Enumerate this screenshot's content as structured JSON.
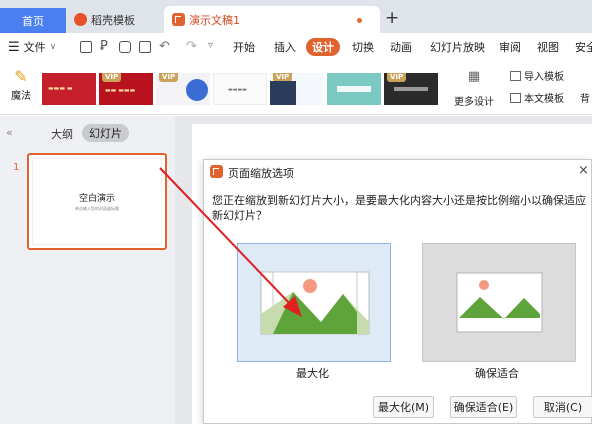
{
  "tabs": {
    "home": "首页",
    "shell": "稻壳模板",
    "doc": "演示文稿1",
    "new_tab": "+"
  },
  "menu": {
    "file": "文件",
    "items": [
      "开始",
      "插入",
      "设计",
      "切换",
      "动画",
      "幻灯片放映",
      "审阅",
      "视图",
      "安全"
    ],
    "active": "设计"
  },
  "ribbon": {
    "magic": "魔法",
    "vip_badge": "VIP",
    "more_design": "更多设计",
    "import_template": "导入模板",
    "text_template": "本文模板",
    "bg": "背"
  },
  "left_panel": {
    "collapse": "«",
    "outline": "大纲",
    "slides": "幻灯片",
    "slide_number": "1",
    "slide_title": "空白演示",
    "slide_subtitle": "单击输入您的封面副标题"
  },
  "dialog": {
    "title": "页面缩放选项",
    "close": "×",
    "message": "您正在缩放到新幻灯片大小，是要最大化内容大小还是按比例缩小以确保适应新幻灯片？",
    "option_max": "最大化",
    "option_fit": "确保适合",
    "btn_max": "最大化(M)",
    "btn_fit": "确保适合(E)",
    "btn_cancel": "取消(C)"
  },
  "colors": {
    "accent": "#e0632e",
    "tab_home": "#4a7ff0",
    "selection_fill": "#dfeaf7",
    "arrow": "#e02020"
  }
}
